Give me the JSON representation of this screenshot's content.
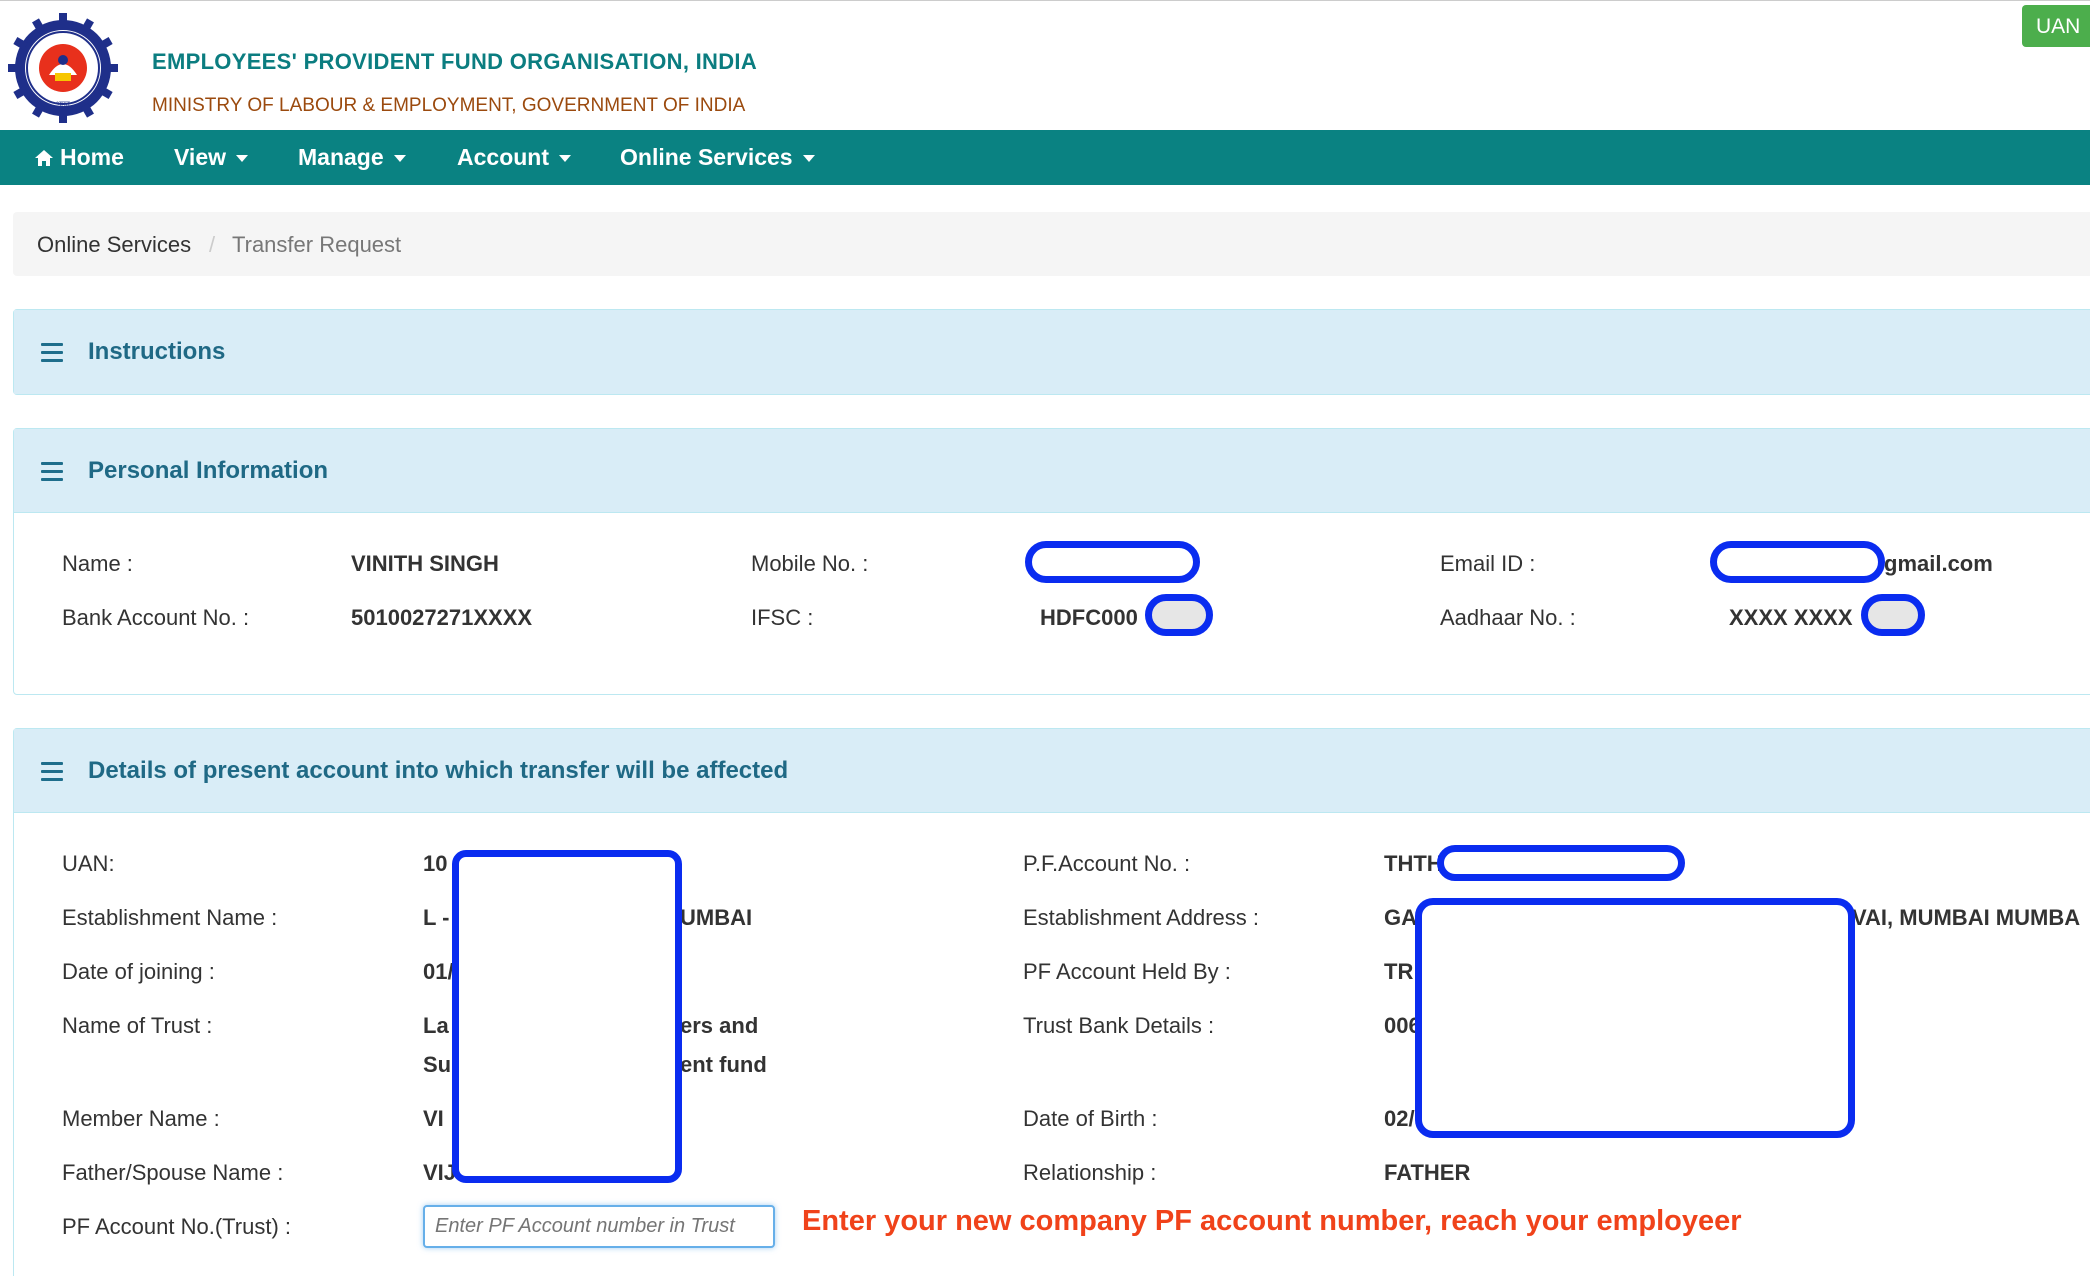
{
  "header": {
    "title": "EMPLOYEES' PROVIDENT FUND ORGANISATION, INDIA",
    "subtitle": "MINISTRY OF LABOUR & EMPLOYMENT, GOVERNMENT OF INDIA",
    "uan_button": "UAN",
    "logo_icon": "epfo-emblem-icon"
  },
  "nav": {
    "home": "Home",
    "view": "View",
    "manage": "Manage",
    "account": "Account",
    "online_services": "Online Services"
  },
  "breadcrumb": {
    "parent": "Online Services",
    "current": "Transfer Request"
  },
  "instructions": {
    "title": "Instructions"
  },
  "personal": {
    "title": "Personal Information",
    "name_label": "Name :",
    "name_value": "VINITH SINGH",
    "mobile_label": "Mobile No. :",
    "mobile_value": "",
    "email_label": "Email ID :",
    "email_value": "gmail.com",
    "bank_label": "Bank Account No. :",
    "bank_value": "5010027271XXXX",
    "ifsc_label": "IFSC :",
    "ifsc_value": "HDFC000",
    "aadhaar_label": "Aadhaar No. :",
    "aadhaar_value": "XXXX XXXX"
  },
  "present_account": {
    "title": "Details of present account into which transfer will be affected",
    "uan_label": "UAN:",
    "uan_value": "10",
    "pf_acc_label": "P.F.Account No. :",
    "pf_acc_value": "THTH",
    "est_name_label": "Establishment Name :",
    "est_name_value_start": "L -",
    "est_name_value_end": "UMBAI",
    "est_addr_label": "Establishment Address :",
    "est_addr_value_start": "GA",
    "est_addr_value_end": "VAI, MUMBAI MUMBA",
    "doj_label": "Date of joining :",
    "doj_value": "01/",
    "held_by_label": "PF Account Held By :",
    "held_by_value": "TR",
    "trust_name_label": "Name of Trust :",
    "trust_name_line1_start": "La",
    "trust_name_line1_end": "ers and",
    "trust_name_line2_start": "Su",
    "trust_name_line2_end": "ent fund",
    "trust_bank_label": "Trust Bank Details :",
    "trust_bank_value": "006",
    "member_label": "Member Name :",
    "member_value": "VI",
    "dob_label": "Date of Birth :",
    "dob_value": "02/",
    "father_label": "Father/Spouse Name :",
    "father_value": "VIJ",
    "relationship_label": "Relationship :",
    "relationship_value": "FATHER",
    "pf_trust_label": "PF Account No.(Trust) :",
    "pf_trust_placeholder": "Enter PF Account number in Trust",
    "hint": "Enter your new company PF account number, reach your employeer"
  },
  "colors": {
    "nav_bg": "#0a8282",
    "panel_heading_bg": "#d9edf7",
    "title_teal": "#0b7d80",
    "subtitle_brown": "#9b4a0e",
    "hint_red": "#f0421a",
    "redaction_blue": "#0a2cf0"
  }
}
